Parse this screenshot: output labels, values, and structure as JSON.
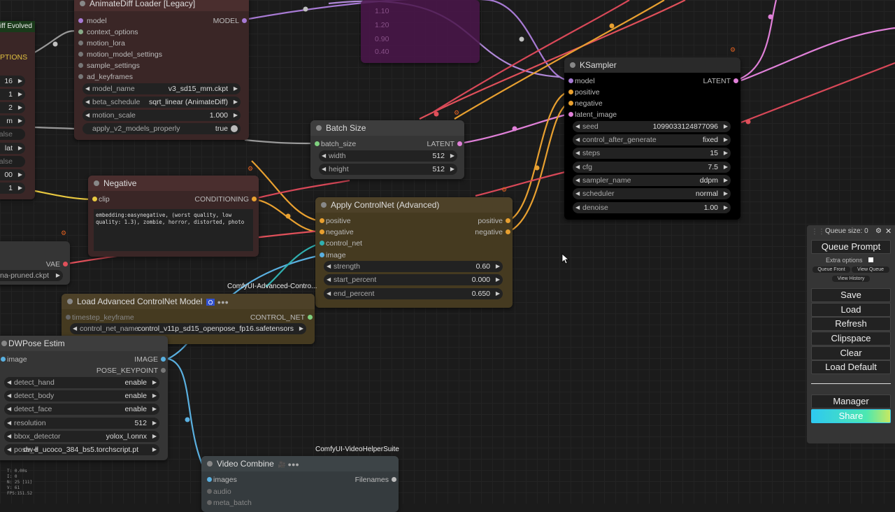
{
  "colors": {
    "canvas": "#1b1b1b",
    "loader_bg": "#3a2626",
    "negative_bg": "#3a2626",
    "batch_bg": "#353535",
    "controlnet_bg": "#453a20",
    "ksampler_bg": "#000000",
    "ksampler_title_bg": "#2a2a2a",
    "purple": "#5a1a5a",
    "video_bg": "#353b3e",
    "share_gradient": "#2ec9f0"
  },
  "left_edge": {
    "title_fragment": "iff Evolved",
    "options_label": "PTIONS",
    "values": [
      "16",
      "1",
      "2",
      "m",
      "alse",
      "lat",
      "alse",
      "00",
      "1"
    ]
  },
  "animatediff": {
    "title": "AnimateDiff Loader [Legacy]",
    "output": "MODEL",
    "inputs": [
      "model",
      "context_options",
      "motion_lora",
      "motion_model_settings",
      "sample_settings",
      "ad_keyframes"
    ],
    "widgets": [
      {
        "label": "model_name",
        "value": "v3_sd15_mm.ckpt"
      },
      {
        "label": "beta_schedule",
        "value": "sqrt_linear (AnimateDiff)"
      },
      {
        "label": "motion_scale",
        "value": "1.000"
      },
      {
        "label": "apply_v2_models_properly",
        "value": "true"
      }
    ]
  },
  "purple_values": [
    "1.10",
    "1.20",
    "0.90",
    "0.40"
  ],
  "batch": {
    "title": "Batch Size",
    "input": "batch_size",
    "output": "LATENT",
    "widgets": [
      {
        "label": "width",
        "value": "512"
      },
      {
        "label": "height",
        "value": "512"
      }
    ]
  },
  "ksampler": {
    "title": "KSampler",
    "output": "LATENT",
    "inputs": [
      "model",
      "positive",
      "negative",
      "latent_image"
    ],
    "widgets": [
      {
        "label": "seed",
        "value": "1099033124877096"
      },
      {
        "label": "control_after_generate",
        "value": "fixed"
      },
      {
        "label": "steps",
        "value": "15"
      },
      {
        "label": "cfg",
        "value": "7.5"
      },
      {
        "label": "sampler_name",
        "value": "ddpm"
      },
      {
        "label": "scheduler",
        "value": "normal"
      },
      {
        "label": "denoise",
        "value": "1.00"
      }
    ]
  },
  "negative": {
    "title": "Negative",
    "input": "clip",
    "output": "CONDITIONING",
    "text": "embedding:easynegative, (worst quality, low quality: 1.3), zombie, horror, distorted, photo"
  },
  "checkpoint": {
    "vae": "VAE",
    "ckpt": "na-pruned.ckpt"
  },
  "apply_cn": {
    "title": "Apply ControlNet (Advanced)",
    "inputs": [
      "positive",
      "negative",
      "control_net",
      "image"
    ],
    "outputs": [
      "positive",
      "negative"
    ],
    "widgets": [
      {
        "label": "strength",
        "value": "0.60"
      },
      {
        "label": "start_percent",
        "value": "0.000"
      },
      {
        "label": "end_percent",
        "value": "0.650"
      }
    ]
  },
  "load_cn": {
    "package": "ComfyUI-Advanced-Contro...",
    "title": "Load Advanced ControlNet Model",
    "input": "timestep_keyframe",
    "output": "CONTROL_NET",
    "widget": {
      "label": "control_net_name",
      "value": "control_v11p_sd15_openpose_fp16.safetensors"
    }
  },
  "dwpose": {
    "title": "DWPose Estim",
    "input": "image",
    "outputs": [
      "IMAGE",
      "POSE_KEYPOINT"
    ],
    "widgets": [
      {
        "label": "detect_hand",
        "value": "enable"
      },
      {
        "label": "detect_body",
        "value": "enable"
      },
      {
        "label": "detect_face",
        "value": "enable"
      },
      {
        "label": "resolution",
        "value": "512"
      },
      {
        "label": "bbox_detector",
        "value": "yolox_l.onnx"
      },
      {
        "label": "pose_e",
        "value": "dw-ll_ucoco_384_bs5.torchscript.pt"
      }
    ]
  },
  "video": {
    "package": "ComfyUI-VideoHelperSuite",
    "title": "Video Combine",
    "inputs": [
      "images",
      "audio",
      "meta_batch"
    ],
    "output": "Filenames"
  },
  "stats": [
    "T: 0.00s",
    "I: 0",
    "N: 25 [11]",
    "V: 61",
    "FPS:151.52"
  ],
  "panel": {
    "queue_size": "Queue size: 0",
    "queue_prompt": "Queue Prompt",
    "extra_options": "Extra options",
    "queue_front": "Queue Front",
    "view_queue": "View Queue",
    "view_history": "View History",
    "buttons": [
      "Save",
      "Load",
      "Refresh",
      "Clipspace",
      "Clear",
      "Load Default"
    ],
    "manager": "Manager",
    "share": "Share"
  }
}
